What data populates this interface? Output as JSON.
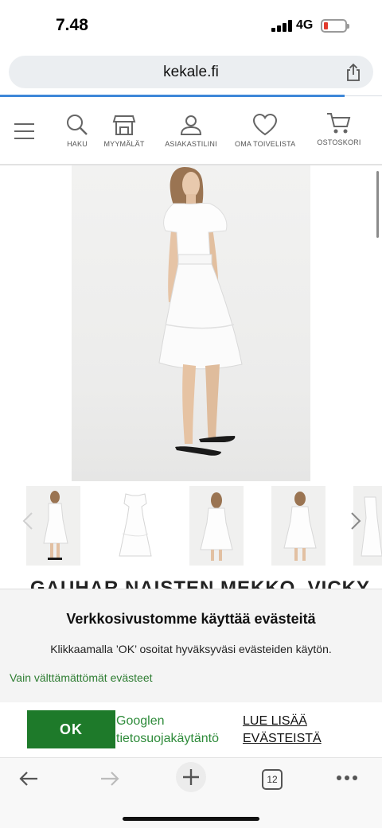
{
  "status_bar": {
    "time": "7.48",
    "network": "4G"
  },
  "browser": {
    "url": "kekale.fi",
    "tab_count": "12"
  },
  "site_nav": {
    "items": [
      {
        "label": "HAKU",
        "icon": "search-icon"
      },
      {
        "label": "MYYMÄLÄT",
        "icon": "store-icon"
      },
      {
        "label": "ASIAKASTILINI",
        "icon": "user-icon"
      },
      {
        "label": "OMA TOIVELISTA",
        "icon": "heart-icon"
      },
      {
        "label": "OSTOSKORI",
        "icon": "cart-icon"
      }
    ]
  },
  "product": {
    "title": "GAUHAR NAISTEN MEKKO, VICKY"
  },
  "cookie": {
    "title": "Verkkosivustomme käyttää evästeitä",
    "text": "Klikkaamalla ’OK’ osoitat hyväksyväsi evästeiden käytön.",
    "essential_link": "Vain välttämättömät evästeet",
    "ok_label": "OK",
    "google_line1": "Googlen",
    "google_line2": "tietosuojakäytäntö",
    "read_more_line1": "LUE LISÄÄ",
    "read_more_line2": "EVÄSTEISTÄ"
  },
  "colors": {
    "accent_green": "#1e7a2a",
    "link_green": "#2e8b3a",
    "progress_blue": "#3e87d8"
  }
}
